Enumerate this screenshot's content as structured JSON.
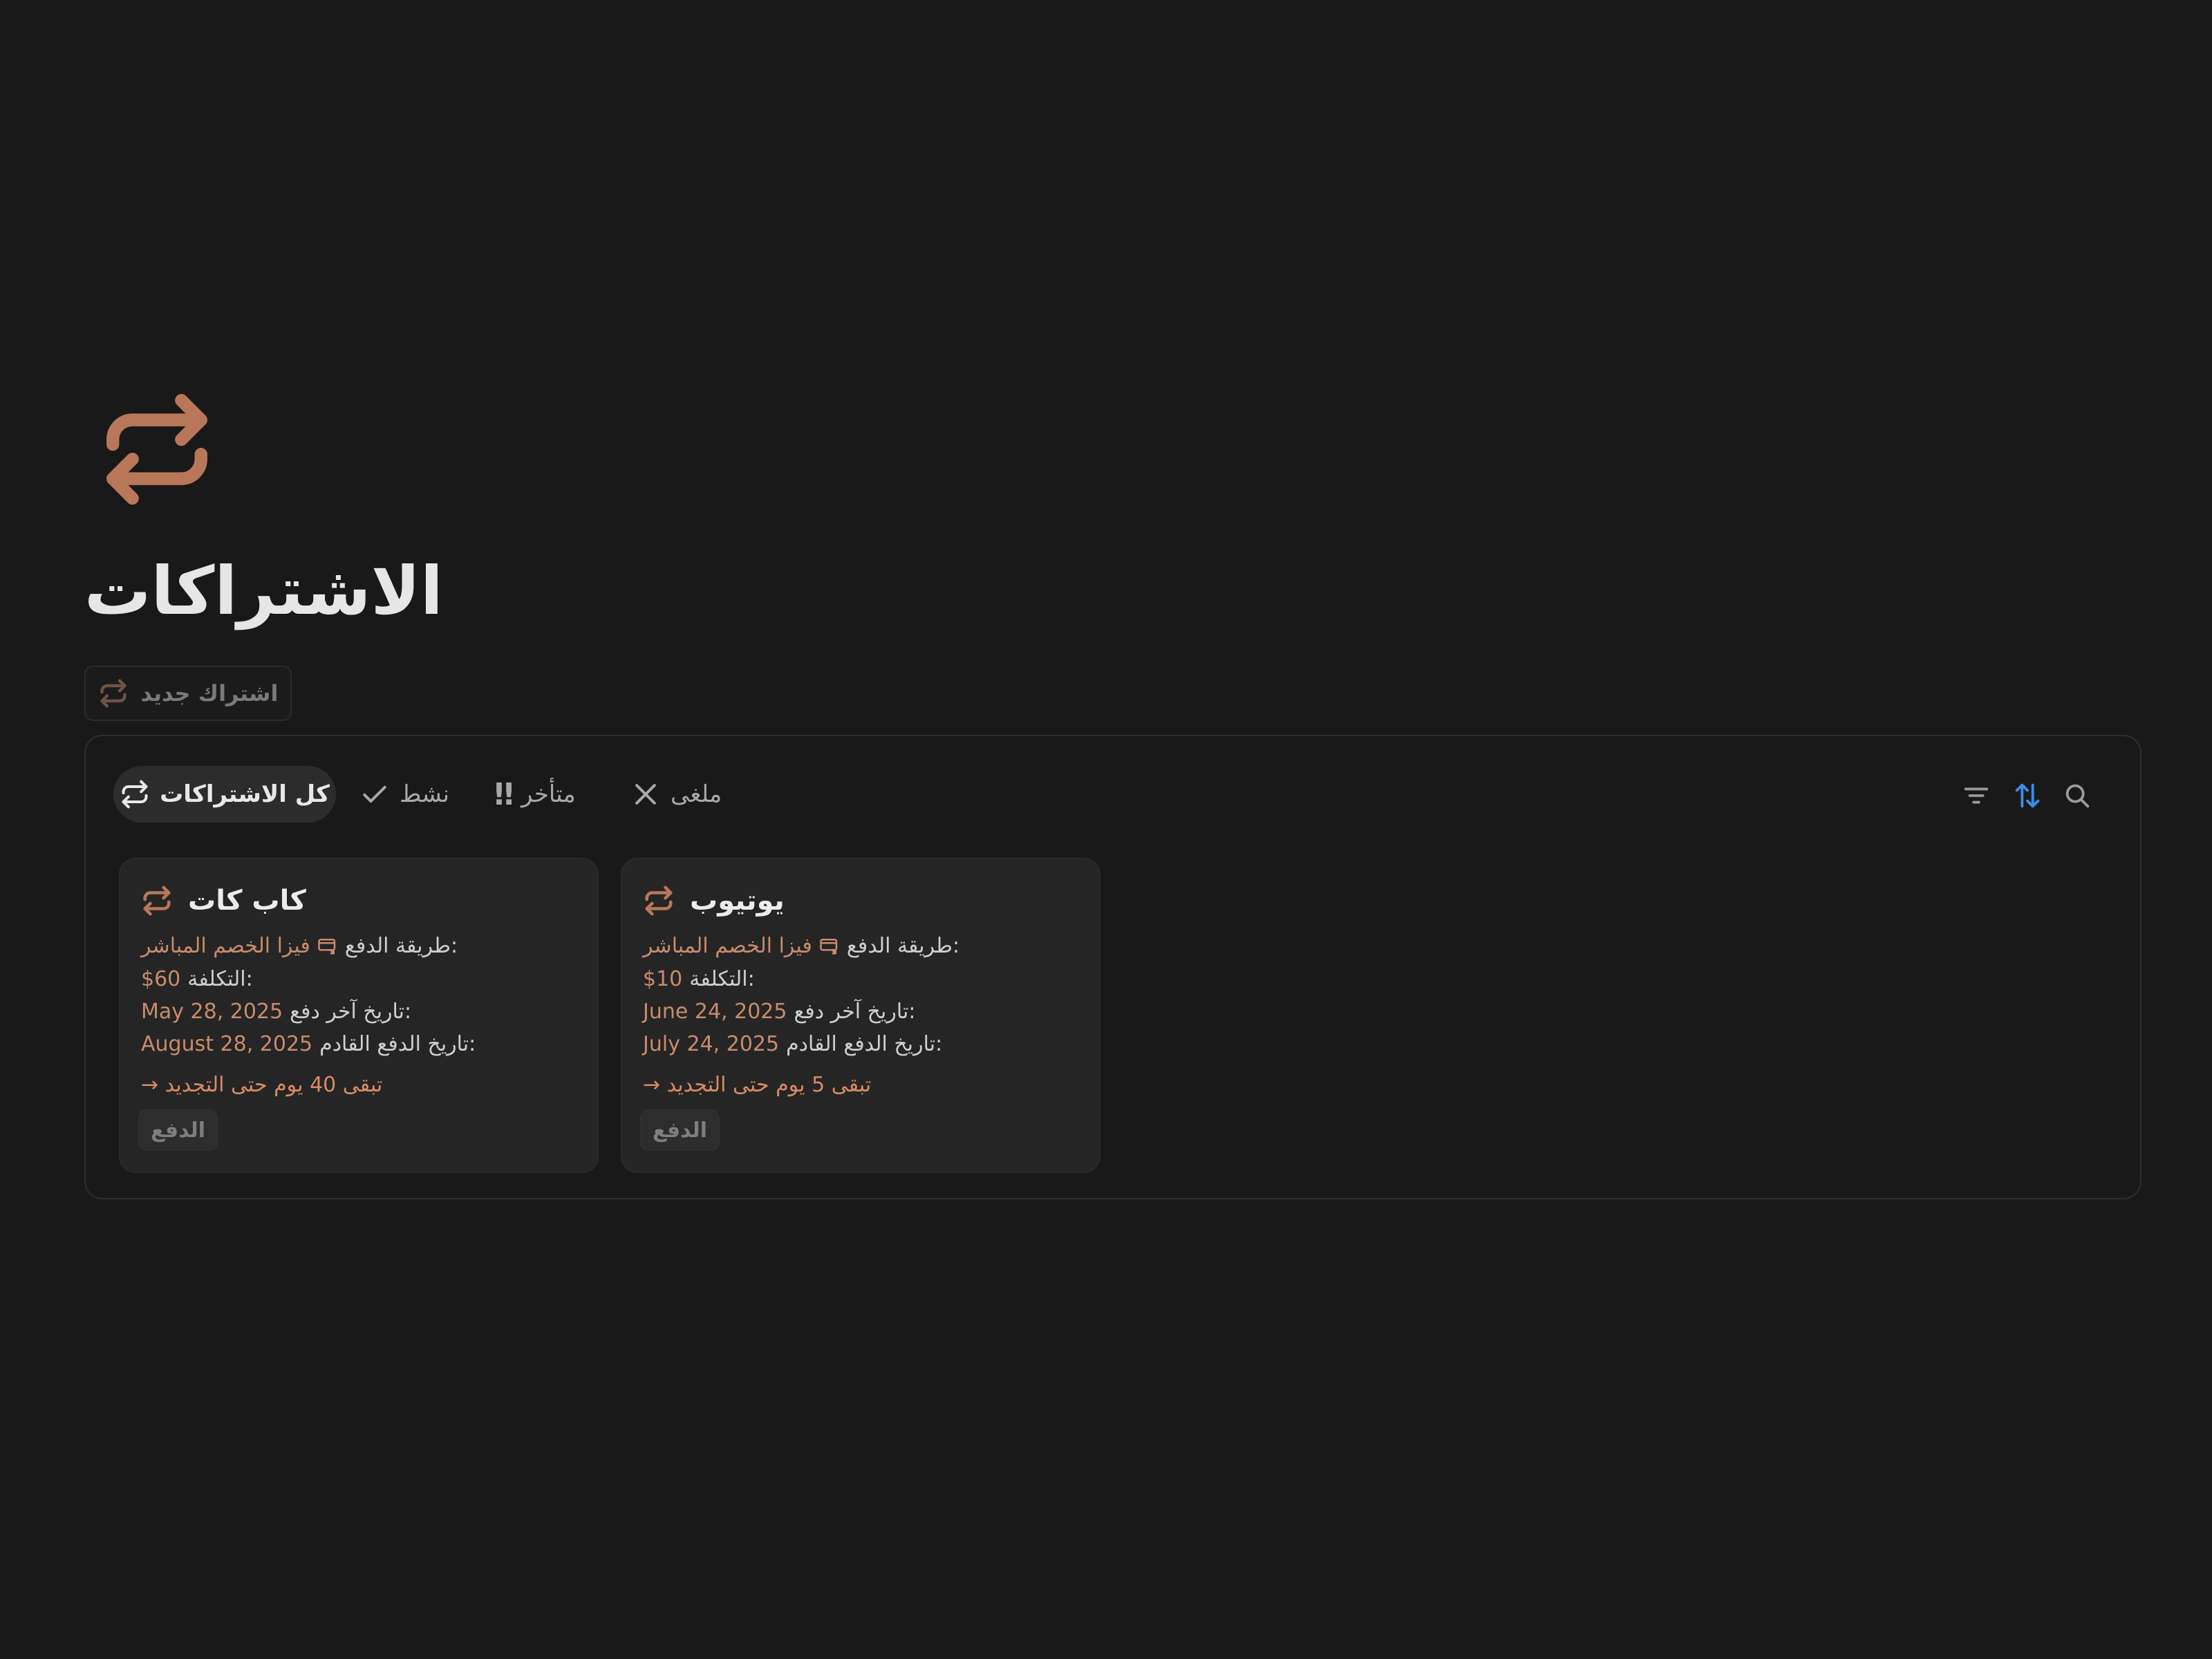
{
  "page": {
    "icon": "repeat-arrows-icon",
    "title": "الاشتراكات",
    "accent_color": "#c98b6b"
  },
  "new_button": {
    "label": "اشتراك جديد",
    "icon": "repeat-arrows-icon"
  },
  "tabs": [
    {
      "label": "كل الاشتراكات",
      "icon": "repeat-arrows-icon",
      "selected": true
    },
    {
      "label": "نشط",
      "icon": "check-icon",
      "selected": false
    },
    {
      "label": "متأخر",
      "icon": "double-exclamation-icon",
      "selected": false
    },
    {
      "label": "ملغى",
      "icon": "x-icon",
      "selected": false
    }
  ],
  "tab_glyphs": {
    "late": "!!"
  },
  "toolbar": {
    "filter_icon": "filter-icon",
    "sort_icon": "sort-icon",
    "search_icon": "search-icon",
    "sort_color": "#3b8ee8"
  },
  "cards": [
    {
      "name": "كاب كات",
      "payment_method_label": "طريقة الدفع:",
      "payment_method": "فيزا الخصم المباشر",
      "cost_label": "التكلفة:",
      "cost": "$60",
      "last_payment_label": "تاريخ آخر دفع:",
      "last_payment": "May 28, 2025",
      "next_payment_label": "تاريخ الدفع القادم:",
      "next_payment": "August 28, 2025",
      "renewal_note": "→ تبقى 40 يوم حتى التجديد",
      "pay_button": "الدفع"
    },
    {
      "name": "يوتيوب",
      "payment_method_label": "طريقة الدفع:",
      "payment_method": "فيزا الخصم المباشر",
      "cost_label": "التكلفة:",
      "cost": "$10",
      "last_payment_label": "تاريخ آخر دفع:",
      "last_payment": "June 24, 2025",
      "next_payment_label": "تاريخ الدفع القادم:",
      "next_payment": "July 24, 2025",
      "renewal_note": "→ تبقى 5 يوم حتى التجديد",
      "pay_button": "الدفع"
    }
  ]
}
